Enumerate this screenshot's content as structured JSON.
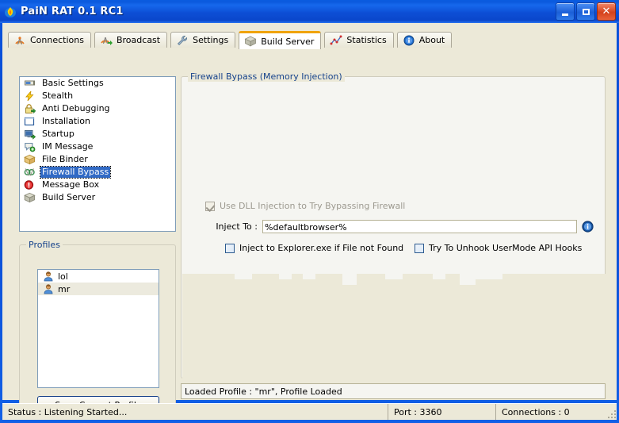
{
  "window": {
    "title": "PaiN RAT 0.1 RC1",
    "icon": "flame-app-icon",
    "buttons": {
      "minimize": "minimize-button",
      "maximize": "maximize-button",
      "close": "close-button"
    }
  },
  "tabs": [
    {
      "label": "Connections",
      "icon": "antenna-icon",
      "active": false
    },
    {
      "label": "Broadcast",
      "icon": "antenna-arrow-icon",
      "active": false
    },
    {
      "label": "Settings",
      "icon": "wrench-icon",
      "active": false
    },
    {
      "label": "Build Server",
      "icon": "package-icon",
      "active": true
    },
    {
      "label": "Statistics",
      "icon": "chart-line-icon",
      "active": false
    },
    {
      "label": "About",
      "icon": "info-circle-icon",
      "active": false
    }
  ],
  "sidebar": {
    "items": [
      {
        "label": "Basic Settings",
        "icon": "window-bar-icon",
        "selected": false
      },
      {
        "label": "Stealth",
        "icon": "lightning-icon",
        "selected": false
      },
      {
        "label": "Anti Debugging",
        "icon": "lock-green-icon",
        "selected": false
      },
      {
        "label": "Installation",
        "icon": "blank-window-icon",
        "selected": false
      },
      {
        "label": "Startup",
        "icon": "monitor-plus-icon",
        "selected": false
      },
      {
        "label": "IM Message",
        "icon": "chat-bubble-icon",
        "selected": false
      },
      {
        "label": "File Binder",
        "icon": "package-open-icon",
        "selected": false
      },
      {
        "label": "Firewall Bypass",
        "icon": "firewall-icon",
        "selected": true
      },
      {
        "label": "Message Box",
        "icon": "error-circle-icon",
        "selected": false
      },
      {
        "label": "Build Server",
        "icon": "package-icon",
        "selected": false
      }
    ]
  },
  "profiles": {
    "group_title": "Profiles",
    "items": [
      {
        "label": "lol",
        "icon": "user-icon",
        "selected": false
      },
      {
        "label": "mr",
        "icon": "user-icon",
        "selected": true
      }
    ],
    "save_button": "Save Current Profile"
  },
  "firewall": {
    "group_title": "Firewall Bypass (Memory Injection)",
    "use_dll_injection": {
      "label": "Use DLL Injection to Try Bypassing Firewall",
      "checked": true,
      "disabled": true
    },
    "inject_to": {
      "label": "Inject To :",
      "value": "%defaultbrowser%",
      "placeholder": "%defaultbrowser%",
      "info_icon": "info-circle-icon"
    },
    "inject_explorer": {
      "label": "Inject to Explorer.exe if File not Found",
      "checked": false
    },
    "unhook_api": {
      "label": "Try To Unhook UserMode API Hooks",
      "checked": false
    }
  },
  "log": {
    "message": "Loaded Profile : \"mr\", Profile Loaded"
  },
  "statusbar": {
    "status": "Status : Listening Started...",
    "port": "Port : 3360",
    "connections": "Connections : 0"
  },
  "colors": {
    "titlebar": "#0b53dc",
    "face": "#ece9d8",
    "panel": "#f5f5f1",
    "selection": "#316ac5",
    "group_title": "#15428b",
    "active_tab_accent": "#f0a30a"
  }
}
